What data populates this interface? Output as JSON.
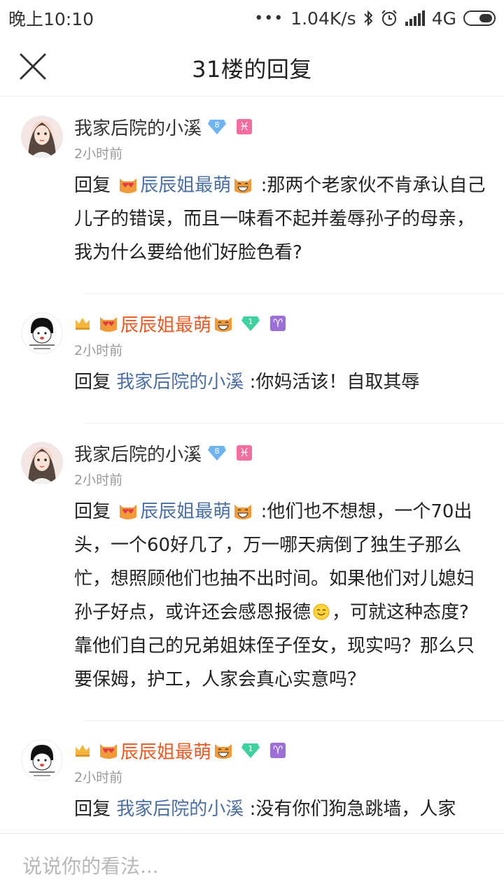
{
  "status_bar": {
    "time": "晚上10:10",
    "dots": "•••",
    "network_speed": "1.04K/s",
    "network_type": "4G"
  },
  "header": {
    "title": "31楼的回复"
  },
  "replies": [
    {
      "user": "我家后院的小溪",
      "level": "8",
      "zodiac": "♓",
      "time": "2小时前",
      "reply_prefix": "回复",
      "reply_to": "辰辰姐最萌",
      "text": ":那两个老家伙不肯承认自己儿子的错误，而且一味看不起并羞辱孙子的母亲，我为什么要给他们好脸色看?"
    },
    {
      "user": "辰辰姐最萌",
      "level": "1",
      "zodiac": "♈",
      "time": "2小时前",
      "reply_prefix": "回复",
      "reply_to": "我家后院的小溪",
      "text": ":你妈活该！自取其辱"
    },
    {
      "user": "我家后院的小溪",
      "level": "8",
      "zodiac": "♓",
      "time": "2小时前",
      "reply_prefix": "回复",
      "reply_to": "辰辰姐最萌",
      "text": ":他们也不想想，一个70出头，一个60好几了，万一哪天病倒了独生子那么忙，想照顾他们也抽不出时间。如果他们对儿媳妇孙子好点，或许还会感恩报德",
      "text2": "，可就这种态度?靠他们自己的兄弟姐妹侄子侄女，现实吗？那么只要保姆，护工，人家会真心实意吗？"
    },
    {
      "user": "辰辰姐最萌",
      "level": "1",
      "zodiac": "♈",
      "time": "2小时前",
      "reply_prefix": "回复",
      "reply_to": "我家后院的小溪",
      "text": ":没有你们狗急跳墙，人家"
    }
  ],
  "input": {
    "placeholder": "说说你的看法..."
  },
  "colors": {
    "link": "#4a6fa5",
    "vip_name": "#e85a22",
    "pisces_badge": "#f06fa0",
    "aries_badge": "#9b6fd6",
    "level8_badge": "#6fb4f0",
    "level1_badge": "#3fd1a0"
  }
}
